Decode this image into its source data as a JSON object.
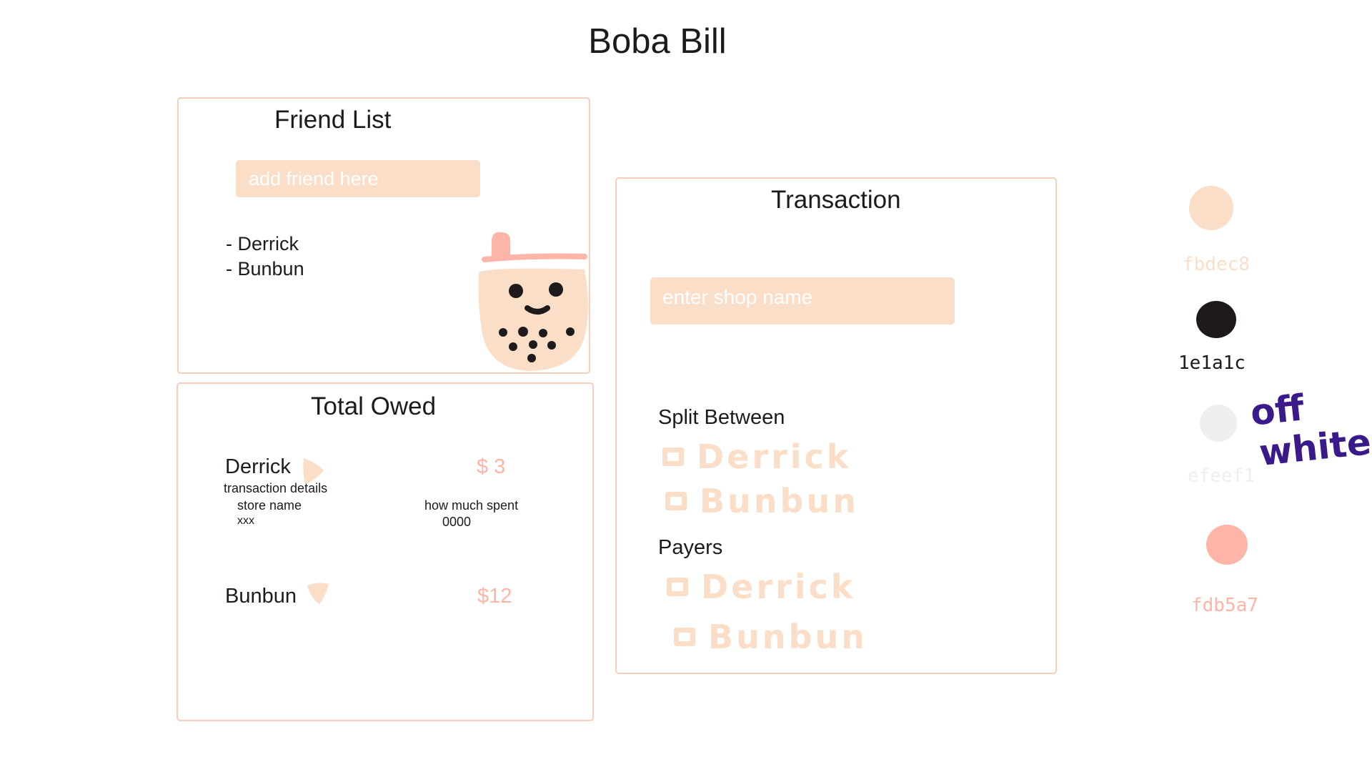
{
  "app": {
    "title": "Boba Bill"
  },
  "friend_list": {
    "title": "Friend List",
    "input_placeholder": "add friend here",
    "friends": [
      "- Derrick",
      "- Bunbun"
    ]
  },
  "total_owed": {
    "title": "Total Owed",
    "entries": [
      {
        "name": "Derrick",
        "amount": "$ 3",
        "expand_icon": "triangle-right-icon",
        "details": {
          "heading": "transaction details",
          "store_label": "store name",
          "store_value": "xxx",
          "spent_label": "how much spent",
          "spent_value": "0000"
        }
      },
      {
        "name": "Bunbun",
        "amount": "$12",
        "expand_icon": "triangle-down-icon"
      }
    ]
  },
  "transaction": {
    "title": "Transaction",
    "shop_placeholder": "enter shop name",
    "split_label": "Split Between",
    "split_options": [
      "Derrick",
      "Bunbun"
    ],
    "payers_label": "Payers",
    "payer_options": [
      "Derrick",
      "Bunbun"
    ]
  },
  "palette": {
    "swatches": [
      {
        "hex": "#fbdec8",
        "label": "fbdec8"
      },
      {
        "hex": "#1e1a1c",
        "label": "1e1a1c"
      },
      {
        "hex": "#efeef1",
        "label": "efeef1"
      },
      {
        "hex": "#fdb5a7",
        "label": "fdb5a7"
      }
    ],
    "note": [
      "off",
      "white"
    ]
  },
  "mascot": {
    "icon": "boba-cup-icon"
  },
  "colors": {
    "accent": "#fbdec8",
    "text": "#1e1a1c",
    "off_white": "#efeef1",
    "amount": "#fdb5a7",
    "border": "#f7cdbd",
    "note": "#3a1a8a"
  }
}
